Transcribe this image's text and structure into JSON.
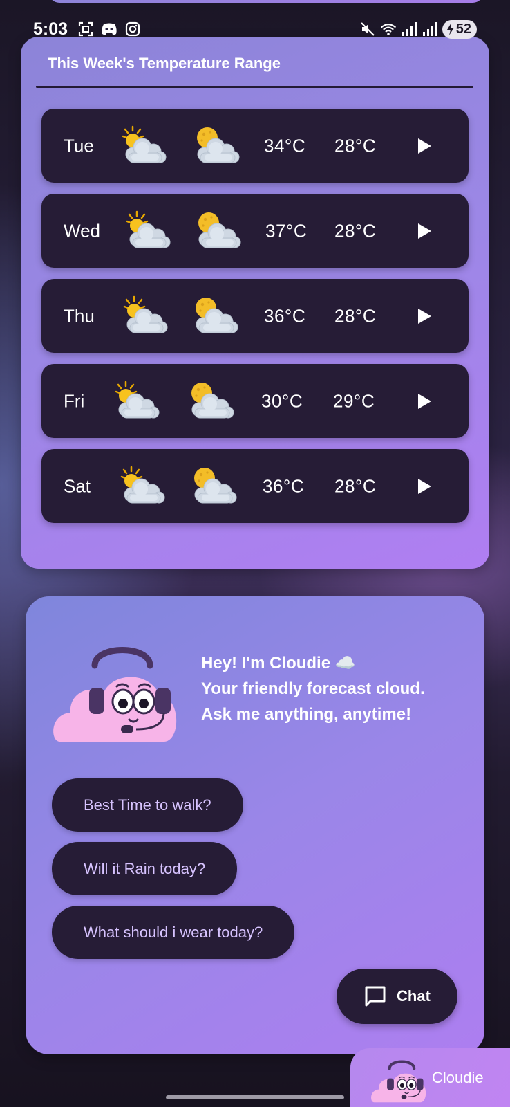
{
  "status_bar": {
    "time": "5:03",
    "battery": "52",
    "icons": [
      "screenshot-icon",
      "discord-icon",
      "instagram-icon",
      "mute-icon",
      "wifi-icon",
      "signal-icon",
      "signal-icon",
      "battery-charging-icon"
    ]
  },
  "week": {
    "title": "This Week's Temperature Range",
    "days": [
      {
        "day": "Tue",
        "day_icon": "partly-sunny-icon",
        "night_icon": "partly-cloudy-night-icon",
        "high": "34°C",
        "low": "28°C"
      },
      {
        "day": "Wed",
        "day_icon": "partly-sunny-icon",
        "night_icon": "partly-cloudy-night-icon",
        "high": "37°C",
        "low": "28°C"
      },
      {
        "day": "Thu",
        "day_icon": "partly-sunny-icon",
        "night_icon": "partly-cloudy-night-icon",
        "high": "36°C",
        "low": "28°C"
      },
      {
        "day": "Fri",
        "day_icon": "partly-sunny-icon",
        "night_icon": "partly-cloudy-night-icon",
        "high": "30°C",
        "low": "29°C"
      },
      {
        "day": "Sat",
        "day_icon": "partly-sunny-icon",
        "night_icon": "partly-cloudy-night-icon",
        "high": "36°C",
        "low": "28°C"
      }
    ]
  },
  "cloudie": {
    "greeting": "Hey! I'm Cloudie ☁️",
    "line2": "Your friendly forecast cloud.",
    "line3": "Ask me anything, anytime!",
    "suggestions": [
      "Best Time to walk?",
      "Will it Rain today?",
      "What should i wear today?"
    ],
    "chat_label": "Chat"
  },
  "bottom_tab": {
    "label": "Cloudie"
  },
  "colors": {
    "card_dark": "#261c36",
    "accent_text": "#d7c3ff",
    "card_gradient_start": "#8c84d8",
    "card_gradient_end": "#b07ef2"
  }
}
